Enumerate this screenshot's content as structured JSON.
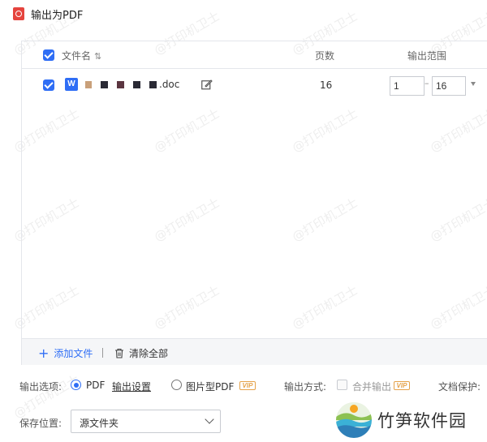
{
  "window": {
    "title": "输出为PDF"
  },
  "table": {
    "headers": {
      "name": "文件名",
      "pages": "页数",
      "range": "输出范围"
    },
    "rows": [
      {
        "filename_suffix": ".doc",
        "pages": "16",
        "range_from": "1",
        "range_to": "16"
      }
    ]
  },
  "panel_footer": {
    "add_files": "添加文件",
    "clear_all": "清除全部"
  },
  "options": {
    "output_options_label": "输出选项:",
    "pdf_option": "PDF",
    "output_settings_link": "输出设置",
    "image_pdf_option": "图片型PDF",
    "vip_badge": "VIP",
    "output_method_label": "输出方式:",
    "merge_output": "合并输出",
    "doc_protect_label": "文档保护:"
  },
  "save": {
    "label": "保存位置:",
    "value": "源文件夹"
  },
  "brand": {
    "name": "竹笋软件园"
  },
  "watermark": {
    "text": "@打印机卫士"
  },
  "colors": {
    "accent": "#2f6ef5",
    "pdf_red": "#e5443e",
    "vip_gold": "#e5a24a"
  }
}
